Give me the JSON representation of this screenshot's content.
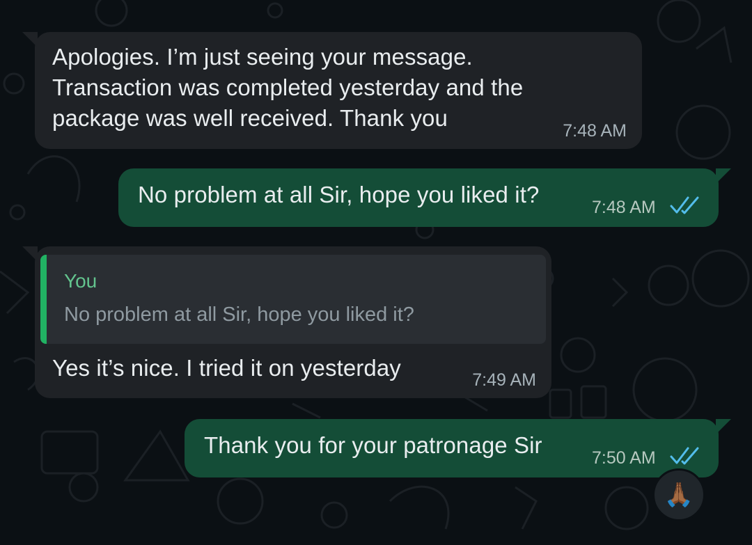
{
  "colors": {
    "incoming_bubble": "#1f2226",
    "outgoing_bubble": "#144d37",
    "read_ticks": "#53bdeb",
    "quote_accent": "#21b263",
    "background": "#0b1014"
  },
  "messages": [
    {
      "direction": "incoming",
      "text": "Apologies. I’m just seeing your message.\nTransaction was completed yesterday and the\npackage was well received. Thank you",
      "time": "7:48 AM"
    },
    {
      "direction": "outgoing",
      "text": "No problem at all Sir, hope you liked it?",
      "time": "7:48 AM",
      "status_icon": "double-check-read-icon"
    },
    {
      "direction": "incoming",
      "quoted": {
        "author": "You",
        "text": "No problem at all Sir, hope you liked it?"
      },
      "text": "Yes it’s nice. I tried it on yesterday",
      "time": "7:49 AM"
    },
    {
      "direction": "outgoing",
      "text": "Thank you for your patronage Sir",
      "time": "7:50 AM",
      "status_icon": "double-check-read-icon",
      "reaction": "🙏🏾"
    }
  ]
}
